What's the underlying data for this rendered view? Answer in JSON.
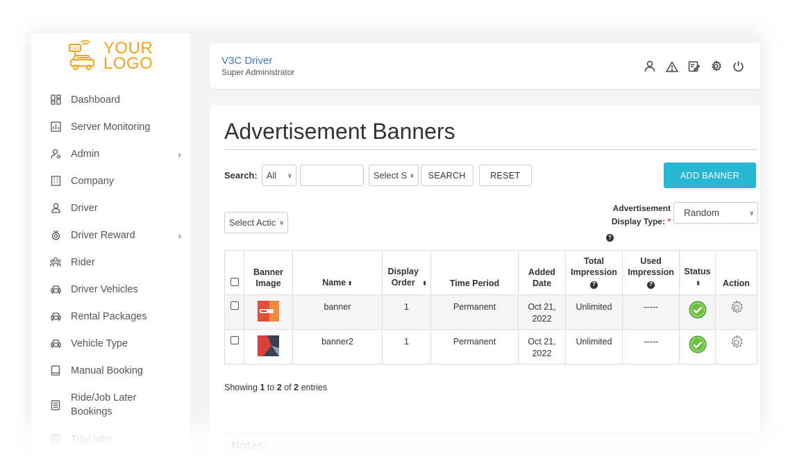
{
  "logo": {
    "line1": "YOUR",
    "line2": "LOGO",
    "badge": "TAXI",
    "color": "#f7a21b"
  },
  "sidebar": {
    "items": [
      {
        "label": "Dashboard",
        "icon": "dashboard-icon"
      },
      {
        "label": "Server Monitoring",
        "icon": "chart-icon"
      },
      {
        "label": "Admin",
        "icon": "admin-user-icon",
        "has_submenu": true
      },
      {
        "label": "Company",
        "icon": "building-icon"
      },
      {
        "label": "Driver",
        "icon": "person-icon"
      },
      {
        "label": "Driver Reward",
        "icon": "medal-icon",
        "has_submenu": true
      },
      {
        "label": "Rider",
        "icon": "group-icon"
      },
      {
        "label": "Driver Vehicles",
        "icon": "car-icon"
      },
      {
        "label": "Rental Packages",
        "icon": "car-icon"
      },
      {
        "label": "Vehicle Type",
        "icon": "car-icon"
      },
      {
        "label": "Manual Booking",
        "icon": "book-icon"
      },
      {
        "label": "Ride/Job Later Bookings",
        "icon": "list-icon"
      },
      {
        "label": "Trip/Jobs",
        "icon": "list-icon"
      }
    ]
  },
  "header": {
    "title": "V3C Driver",
    "subtitle": "Super Administrator",
    "icons": [
      "user-icon",
      "warning-icon",
      "edit-icon",
      "settings-icon",
      "power-icon"
    ]
  },
  "page": {
    "title": "Advertisement Banners",
    "search_label": "Search:",
    "search_filter_value": "All",
    "search_input_value": "",
    "status_select_value": "Select S",
    "search_button": "SEARCH",
    "reset_button": "RESET",
    "add_button": "ADD BANNER",
    "action_select_value": "Select Actic",
    "display_type_label": "Advertisement Display Type:",
    "display_type_value": "Random"
  },
  "table": {
    "headers": {
      "image": "Banner Image",
      "name": "Name",
      "order": "Display Order",
      "period": "Time Period",
      "added": "Added Date",
      "total": "Total Impression",
      "used": "Used Impression",
      "status": "Status",
      "action": "Action"
    },
    "rows": [
      {
        "name": "banner",
        "order": "1",
        "period": "Permanent",
        "added": "Oct 21, 2022",
        "total": "Unlimited",
        "used": "-----"
      },
      {
        "name": "banner2",
        "order": "1",
        "period": "Permanent",
        "added": "Oct 21, 2022",
        "total": "Unlimited",
        "used": "-----"
      }
    ]
  },
  "showing": {
    "prefix": "Showing",
    "from": "1",
    "to_word": "to",
    "to": "2",
    "of_word": "of",
    "total": "2",
    "suffix": "entries"
  },
  "notes": {
    "title": "Notes:"
  },
  "colors": {
    "accent": "#27b7d4",
    "link": "#3b7bbf",
    "status_active": "#5cb85c"
  }
}
